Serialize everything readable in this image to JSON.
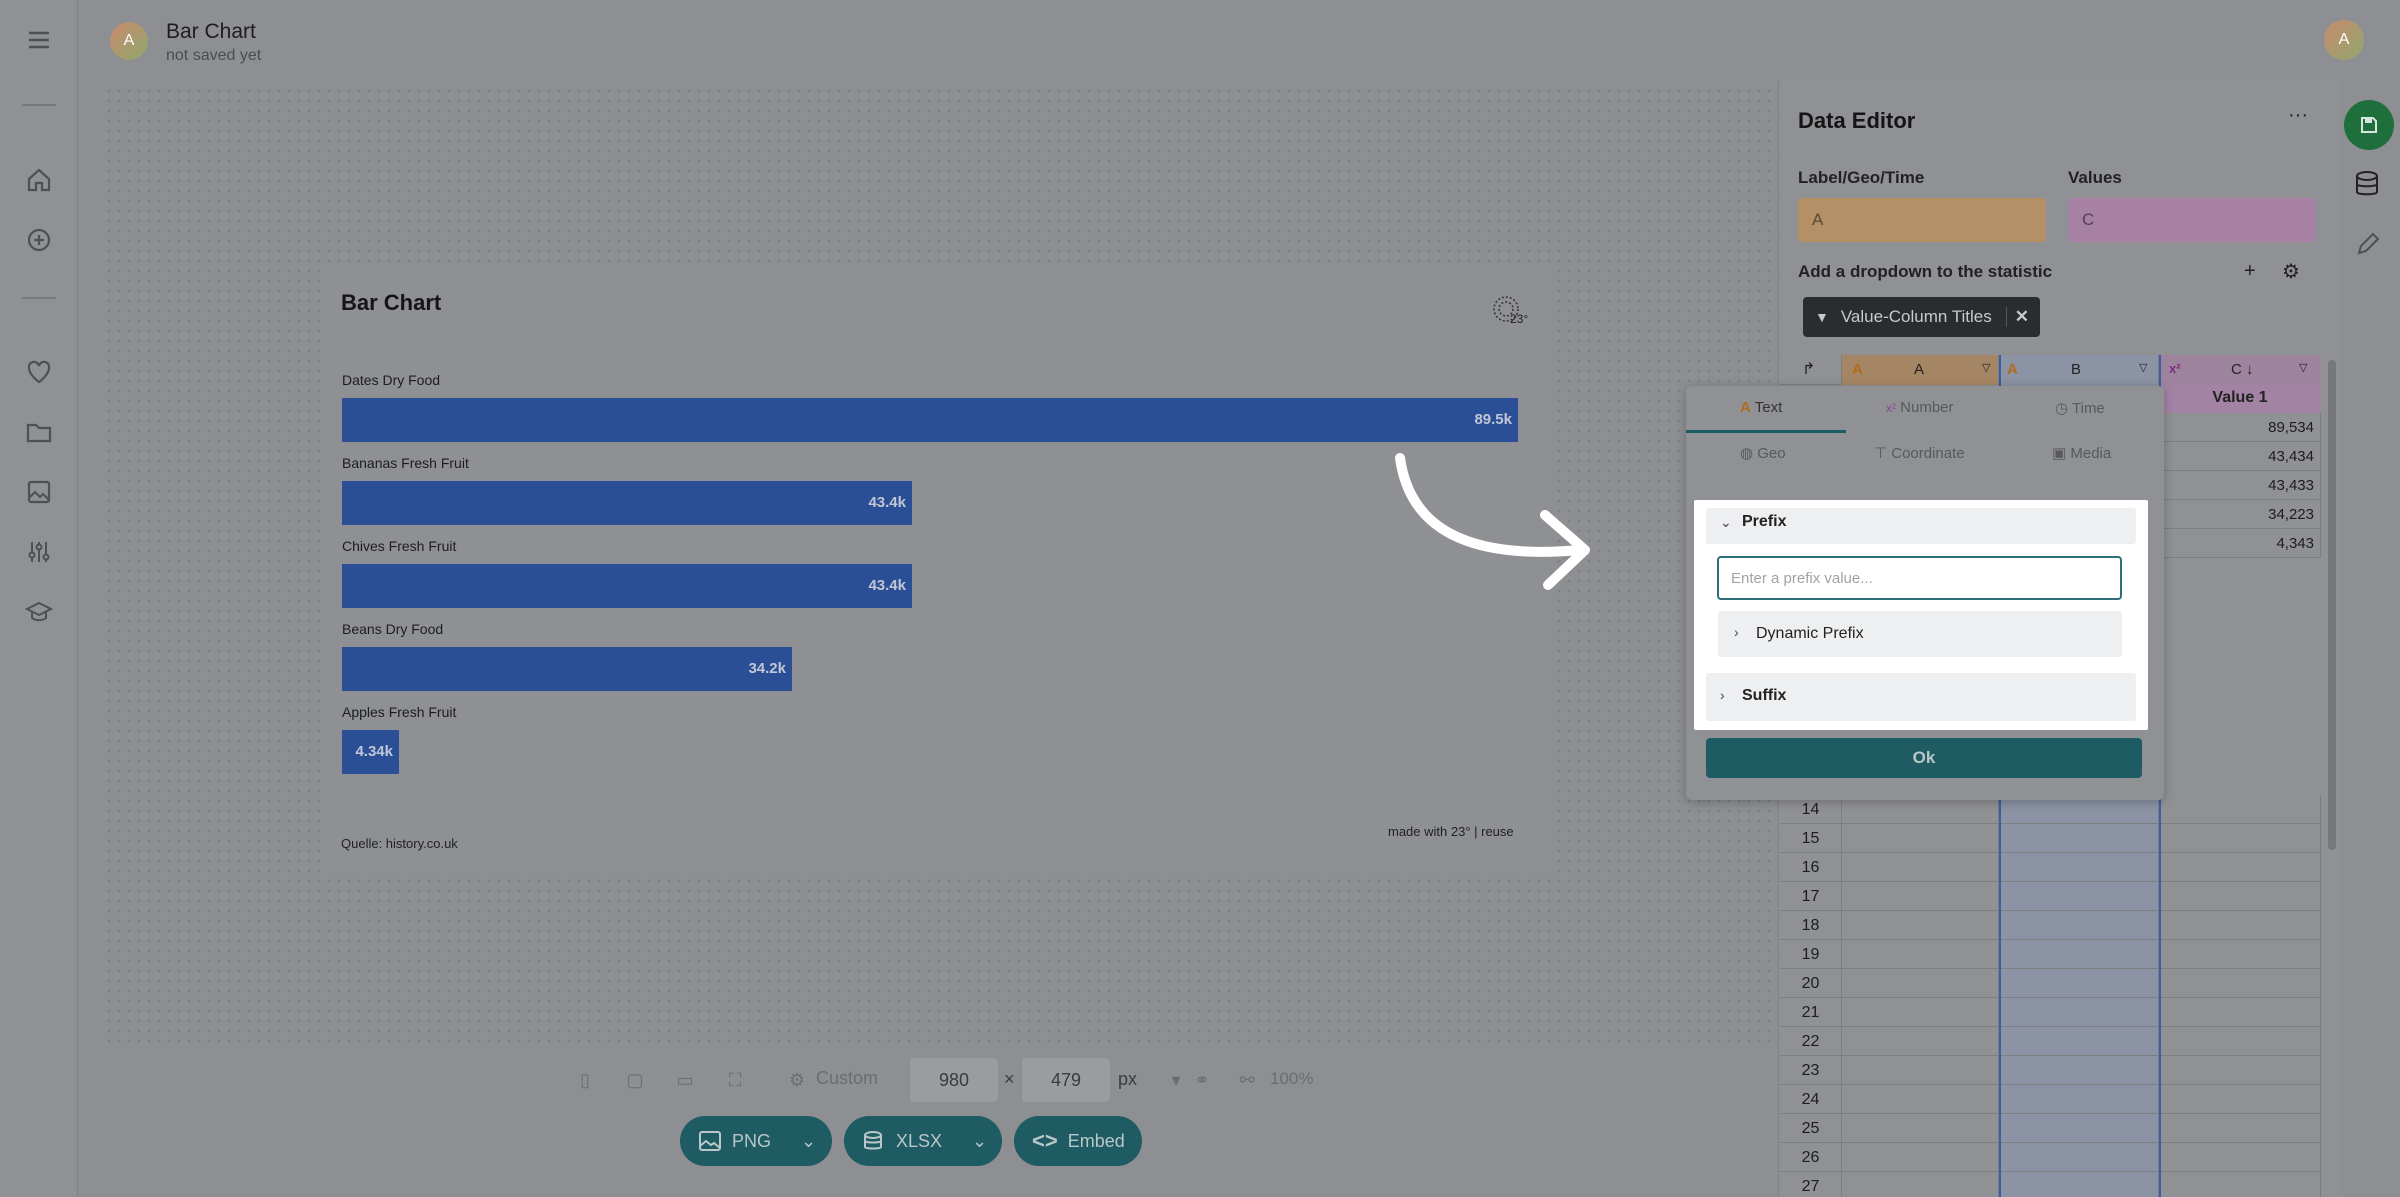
{
  "app": {
    "title": "Bar Chart",
    "subtitle": "not saved yet",
    "avatar_initial": "A"
  },
  "chart": {
    "title": "Bar Chart",
    "source": "Quelle: history.co.uk",
    "credit": "made with 23° | reuse"
  },
  "chart_data": {
    "type": "bar",
    "orientation": "horizontal",
    "title": "Bar Chart",
    "categories": [
      "Dates Dry Food",
      "Bananas Fresh Fruit",
      "Chives Fresh Fruit",
      "Beans Dry Food",
      "Apples Fresh Fruit"
    ],
    "values": [
      89534,
      43434,
      43433,
      34223,
      4343
    ],
    "labels": [
      "89.5k",
      "43.4k",
      "43.4k",
      "34.2k",
      "4.34k"
    ],
    "xlim": [
      0,
      89534
    ],
    "bar_color": "#2a4f96"
  },
  "toolbar": {
    "preset": "Custom",
    "width": "980",
    "height": "479",
    "times": "×",
    "unit": "px",
    "zoom": "100%",
    "png": "PNG",
    "xlsx": "XLSX",
    "embed": "Embed"
  },
  "editor": {
    "title": "Data Editor",
    "more": "···",
    "label_field": "Label/Geo/Time",
    "label_value": "A",
    "values_field": "Values",
    "values_value": "C",
    "dropdown_label": "Add a dropdown to the statistic",
    "chip": "Value-Column Titles",
    "col_a": "A",
    "col_b": "B",
    "col_c": "C ↓",
    "col_c_title": "Value 1",
    "cells": [
      "89,534",
      "43,434",
      "43,433",
      "34,223",
      "4,343"
    ],
    "rows": [
      "14",
      "15",
      "16",
      "17",
      "18",
      "19",
      "20",
      "21",
      "22",
      "23",
      "24",
      "25",
      "26",
      "27"
    ]
  },
  "popover": {
    "tabs": [
      "Text",
      "Number",
      "Time",
      "Geo",
      "Coordinate",
      "Media"
    ],
    "prefix": "Prefix",
    "prefix_placeholder": "Enter a prefix value...",
    "dynamic_prefix": "Dynamic Prefix",
    "suffix": "Suffix",
    "ok": "Ok"
  },
  "colors": {
    "accent": "#1f5b63",
    "label_col": "#e8b37a",
    "value_col": "#c98fc6"
  }
}
